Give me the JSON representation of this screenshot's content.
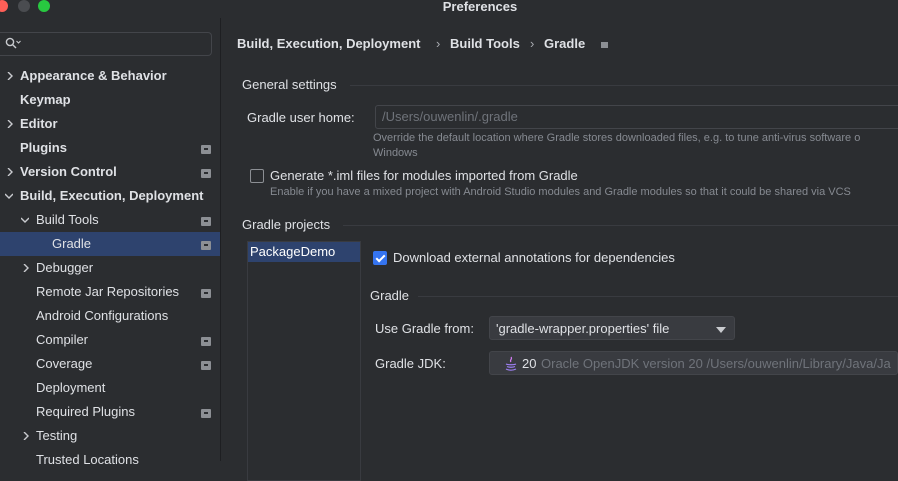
{
  "window": {
    "title": "Preferences"
  },
  "sidebar": {
    "search_placeholder": "",
    "items": [
      {
        "label": "Appearance & Behavior",
        "bold": true
      },
      {
        "label": "Keymap",
        "bold": true
      },
      {
        "label": "Editor",
        "bold": true
      },
      {
        "label": "Plugins",
        "bold": true
      },
      {
        "label": "Version Control",
        "bold": true
      },
      {
        "label": "Build, Execution, Deployment",
        "bold": true
      },
      {
        "label": "Build Tools"
      },
      {
        "label": "Gradle"
      },
      {
        "label": "Debugger"
      },
      {
        "label": "Remote Jar Repositories"
      },
      {
        "label": "Android Configurations"
      },
      {
        "label": "Compiler"
      },
      {
        "label": "Coverage"
      },
      {
        "label": "Deployment"
      },
      {
        "label": "Required Plugins"
      },
      {
        "label": "Testing"
      },
      {
        "label": "Trusted Locations"
      }
    ]
  },
  "breadcrumb": {
    "level1": "Build, Execution, Deployment",
    "level2": "Build Tools",
    "level3": "Gradle",
    "separator": "›"
  },
  "general": {
    "title": "General settings",
    "user_home_label": "Gradle user home:",
    "user_home_value": "/Users/ouwenlin/.gradle",
    "user_home_hint_1": "Override the default location where Gradle stores downloaded files, e.g. to tune anti-virus software o",
    "user_home_hint_2": "Windows",
    "iml_label": "Generate *.iml files for modules imported from Gradle",
    "iml_hint": "Enable if you have a mixed project with Android Studio modules and Gradle modules so that it could be shared via VCS"
  },
  "projects": {
    "title": "Gradle projects",
    "list": [
      "PackageDemo"
    ],
    "download_annotations_label": "Download external annotations for dependencies",
    "gradle_section_title": "Gradle",
    "use_gradle_from_label": "Use Gradle from:",
    "use_gradle_from_value": "'gradle-wrapper.properties' file",
    "jdk_label": "Gradle JDK:",
    "jdk_version": "20",
    "jdk_detail": "Oracle OpenJDK version 20 /Users/ouwenlin/Library/Java/Ja"
  },
  "colors": {
    "background": "#2b2d30",
    "selection": "#2e436e",
    "accent": "#3574f0",
    "text": "#dfe1e5",
    "hint": "#868a91"
  }
}
